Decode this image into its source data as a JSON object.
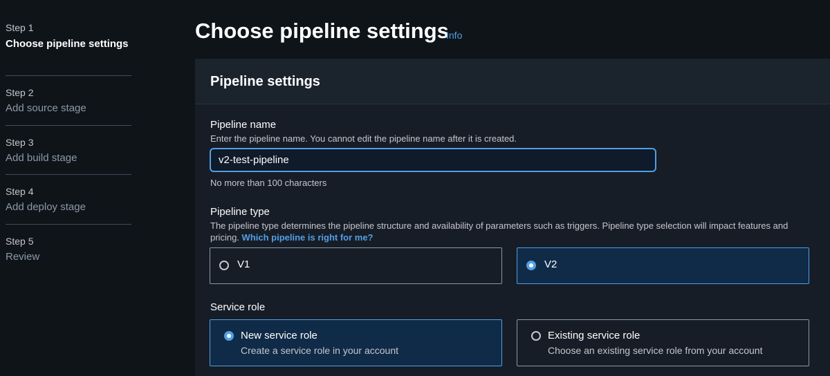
{
  "sidebar": {
    "steps": [
      {
        "number": "Step 1",
        "title": "Choose pipeline settings"
      },
      {
        "number": "Step 2",
        "title": "Add source stage"
      },
      {
        "number": "Step 3",
        "title": "Add build stage"
      },
      {
        "number": "Step 4",
        "title": "Add deploy stage"
      },
      {
        "number": "Step 5",
        "title": "Review"
      }
    ],
    "active_step": 1
  },
  "header": {
    "title": "Choose pipeline settings",
    "info_link": "Info"
  },
  "panel": {
    "title": "Pipeline settings",
    "pipeline_name": {
      "label": "Pipeline name",
      "description": "Enter the pipeline name. You cannot edit the pipeline name after it is created.",
      "value": "v2-test-pipeline",
      "constraint": "No more than 100 characters"
    },
    "pipeline_type": {
      "label": "Pipeline type",
      "description": "The pipeline type determines the pipeline structure and availability of parameters such as triggers. Pipeline type selection will impact features and pricing.",
      "link": "Which pipeline is right for me?",
      "options": [
        {
          "label": "V1",
          "selected": false
        },
        {
          "label": "V2",
          "selected": true
        }
      ]
    },
    "service_role": {
      "label": "Service role",
      "options": [
        {
          "label": "New service role",
          "description": "Create a service role in your account",
          "selected": true
        },
        {
          "label": "Existing service role",
          "description": "Choose an existing service role from your account",
          "selected": false
        }
      ]
    }
  },
  "colors": {
    "background": "#0f1419",
    "accent": "#539fe5",
    "panel": "#161d26"
  }
}
